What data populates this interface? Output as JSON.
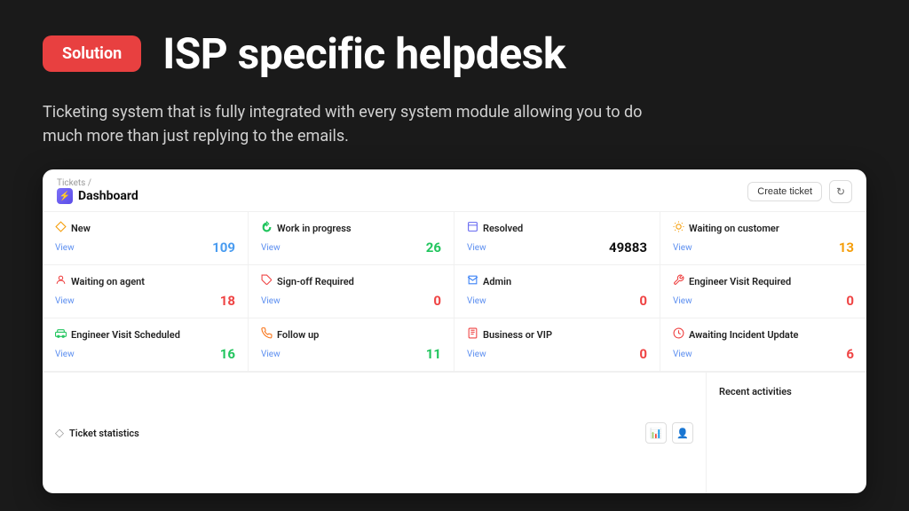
{
  "badge": {
    "label": "Solution"
  },
  "hero": {
    "title": "ISP specific helpdesk",
    "subtitle": "Ticketing system that is fully integrated with every system module allowing you to do much more than just replying to the emails."
  },
  "dashboard": {
    "breadcrumb": "Tickets /",
    "title": "Dashboard",
    "create_ticket_label": "Create ticket",
    "refresh_icon": "↻",
    "stats": [
      {
        "icon": "◇",
        "label": "New",
        "view": "View",
        "count": "109",
        "count_class": "count-blue",
        "icon_color": "#f59e0b"
      },
      {
        "icon": "⟳",
        "label": "Work in progress",
        "view": "View",
        "count": "26",
        "count_class": "count-green",
        "icon_color": "#22c55e"
      },
      {
        "icon": "⊡",
        "label": "Resolved",
        "view": "View",
        "count": "49883",
        "count_class": "count-dark",
        "icon_color": "#6366f1"
      },
      {
        "icon": "☀",
        "label": "Waiting on customer",
        "view": "View",
        "count": "13",
        "count_class": "count-orange",
        "icon_color": "#f59e0b"
      },
      {
        "icon": "👤",
        "label": "Waiting on agent",
        "view": "View",
        "count": "18",
        "count_class": "count-red",
        "icon_color": "#ef4444"
      },
      {
        "icon": "🏷",
        "label": "Sign-off Required",
        "view": "View",
        "count": "0",
        "count_class": "count-red",
        "icon_color": "#ef4444"
      },
      {
        "icon": "✉",
        "label": "Admin",
        "view": "View",
        "count": "0",
        "count_class": "count-red",
        "icon_color": "#3b82f6"
      },
      {
        "icon": "🔧",
        "label": "Engineer Visit Required",
        "view": "View",
        "count": "0",
        "count_class": "count-red",
        "icon_color": "#ef4444"
      },
      {
        "icon": "🚗",
        "label": "Engineer Visit Scheduled",
        "view": "View",
        "count": "16",
        "count_class": "count-green",
        "icon_color": "#22c55e"
      },
      {
        "icon": "📞",
        "label": "Follow up",
        "view": "View",
        "count": "11",
        "count_class": "count-green",
        "icon_color": "#f97316"
      },
      {
        "icon": "📋",
        "label": "Business or VIP",
        "view": "View",
        "count": "0",
        "count_class": "count-red",
        "icon_color": "#ef4444"
      },
      {
        "icon": "⏰",
        "label": "Awaiting Incident Update",
        "view": "View",
        "count": "6",
        "count_class": "count-red",
        "icon_color": "#ef4444"
      }
    ],
    "ticket_stats_label": "Ticket statistics",
    "recent_activities_label": "Recent activities",
    "chart_icon": "📊",
    "user_icon": "👤"
  }
}
